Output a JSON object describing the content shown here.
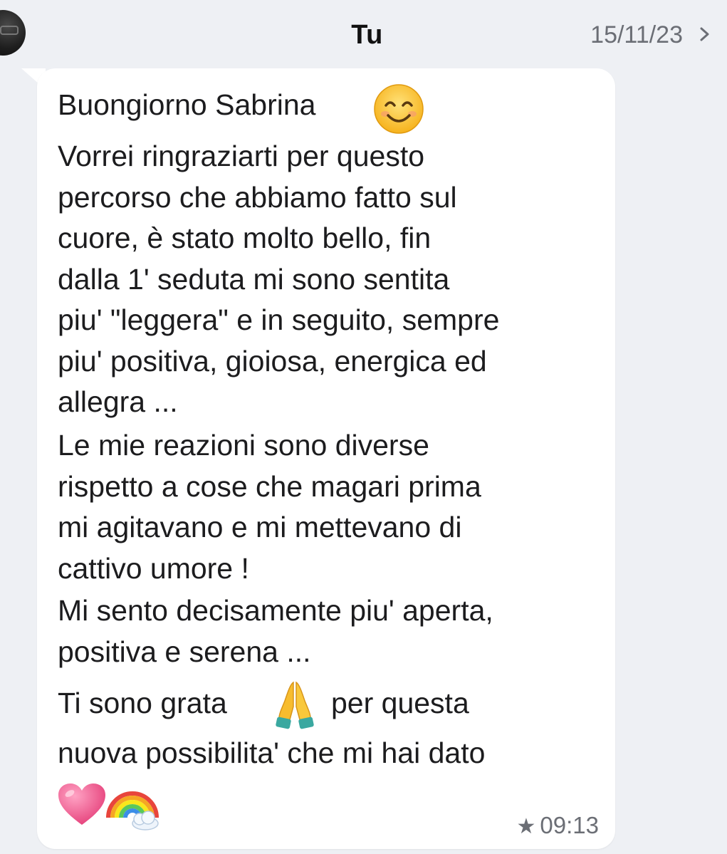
{
  "header": {
    "contact_name": "Tu",
    "date": "15/11/23"
  },
  "message": {
    "greeting": "Buongiorno Sabrina",
    "paragraph_1": "Vorrei ringraziarti per questo\npercorso che abbiamo fatto sul\ncuore, è stato molto bello, fin\ndalla 1' seduta mi sono sentita\npiu' \"leggera\" e in seguito, sempre\npiu' positiva, gioiosa, energica ed\nallegra ...",
    "paragraph_2": "Le mie reazioni sono diverse\nrispetto a cose che magari prima\nmi agitavano e mi mettevano di\ncattivo umore !",
    "paragraph_3": "Mi sento decisamente piu' aperta,\npositiva e serena ...",
    "closing_a": "Ti sono grata",
    "closing_b": "per questa",
    "closing_c": "nuova possibilita' che mi hai dato",
    "time": "09:13"
  },
  "icons": {
    "smile": "smiling-face-icon",
    "pray": "folded-hands-icon",
    "heart": "pink-heart-icon",
    "rainbow": "rainbow-icon",
    "star": "star-icon",
    "chevron": "chevron-right-icon"
  },
  "colors": {
    "background": "#eef0f4",
    "bubble": "#ffffff",
    "text": "#1c1c1e",
    "meta_text": "#6b6e75",
    "heart": "#f26b9c"
  }
}
